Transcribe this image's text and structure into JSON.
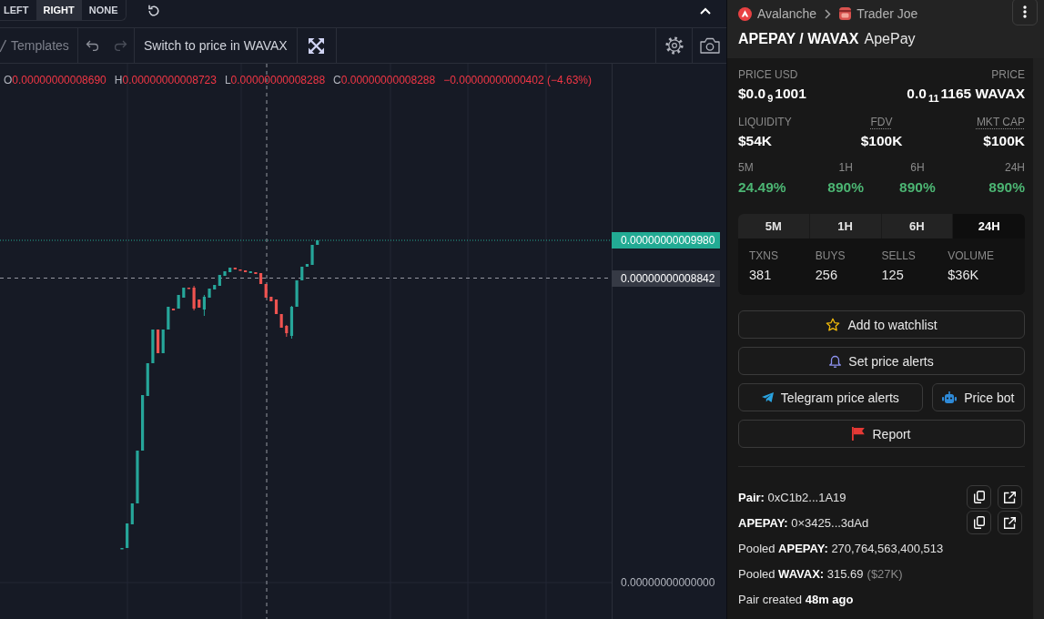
{
  "chart_toolbar": {
    "scale_modes": [
      {
        "label": "LEFT",
        "selected": false
      },
      {
        "label": "RIGHT",
        "selected": true
      },
      {
        "label": "NONE",
        "selected": false
      }
    ]
  },
  "chart_header": {
    "templates": "Templates",
    "history": [
      {
        "kind": "undo",
        "disabled": false
      },
      {
        "kind": "redo",
        "disabled": true
      }
    ],
    "switch_price": "Switch to price in WAVAX"
  },
  "legend": {
    "ohlc": [
      {
        "key": "O",
        "value": "0.00000000008690"
      },
      {
        "key": "H",
        "value": "0.00000000008723"
      },
      {
        "key": "L",
        "value": "0.00000000008288"
      },
      {
        "key": "C",
        "value": "0.00000000008288"
      }
    ],
    "change": "−0.00000000000402 (−4.63%)"
  },
  "price_axis": {
    "labels": [
      {
        "kind": "last",
        "text": "0.00000000009980"
      },
      {
        "kind": "crosshair",
        "text": "0.00000000008842"
      },
      {
        "kind": "tick",
        "text": "0.00000000000000"
      }
    ]
  },
  "pair_header": {
    "chain": "Avalanche",
    "dex": "Trader Joe",
    "pair": "APEPAY / WAVAX",
    "name": "ApePay"
  },
  "prices": [
    {
      "label": "PRICE USD",
      "lead": "$0.0",
      "zeros": "9",
      "tail": "1001"
    },
    {
      "label": "PRICE",
      "lead": "0.0",
      "zeros": "11",
      "tail": "1165 WAVAX"
    }
  ],
  "metrics": [
    {
      "label": "LIQUIDITY",
      "value": "$54K",
      "dotted_underline": false
    },
    {
      "label": "FDV",
      "value": "$100K",
      "dotted_underline": true
    },
    {
      "label": "MKT CAP",
      "value": "$100K",
      "dotted_underline": true
    }
  ],
  "changes": [
    {
      "label": "5M",
      "value": "24.49%",
      "positive": true
    },
    {
      "label": "1H",
      "value": "890%",
      "positive": true
    },
    {
      "label": "6H",
      "value": "890%",
      "positive": true
    },
    {
      "label": "24H",
      "value": "890%",
      "positive": true
    }
  ],
  "period_tabs": [
    {
      "label": "5M",
      "selected": false
    },
    {
      "label": "1H",
      "selected": false
    },
    {
      "label": "6H",
      "selected": false
    },
    {
      "label": "24H",
      "selected": true
    }
  ],
  "txn_stats": [
    {
      "label": "TXNS",
      "value": "381"
    },
    {
      "label": "BUYS",
      "value": "256"
    },
    {
      "label": "SELLS",
      "value": "125"
    },
    {
      "label": "VOLUME",
      "value": "$36K"
    }
  ],
  "action_rows": [
    [
      {
        "kind": "watchlist",
        "label": "Add to watchlist"
      }
    ],
    [
      {
        "kind": "alerts",
        "label": "Set price alerts"
      }
    ],
    [
      {
        "kind": "telegram",
        "label": "Telegram price alerts"
      },
      {
        "kind": "bot",
        "label": "Price bot"
      }
    ],
    [
      {
        "kind": "report",
        "label": "Report"
      }
    ]
  ],
  "info_lines": [
    {
      "kind": "address",
      "text": "**Pair:** 0xC1b2...1A19"
    },
    {
      "kind": "address",
      "text": "**APEPAY:** 0×3425...3dAd"
    },
    {
      "kind": "stat",
      "text": "Pooled **APEPAY:** 270,764,563,400,513"
    },
    {
      "kind": "stat",
      "text": "Pooled **WAVAX:** 315.69",
      "note": "($27K)"
    },
    {
      "kind": "stat",
      "text": "Pair created **48m ago**"
    }
  ]
}
